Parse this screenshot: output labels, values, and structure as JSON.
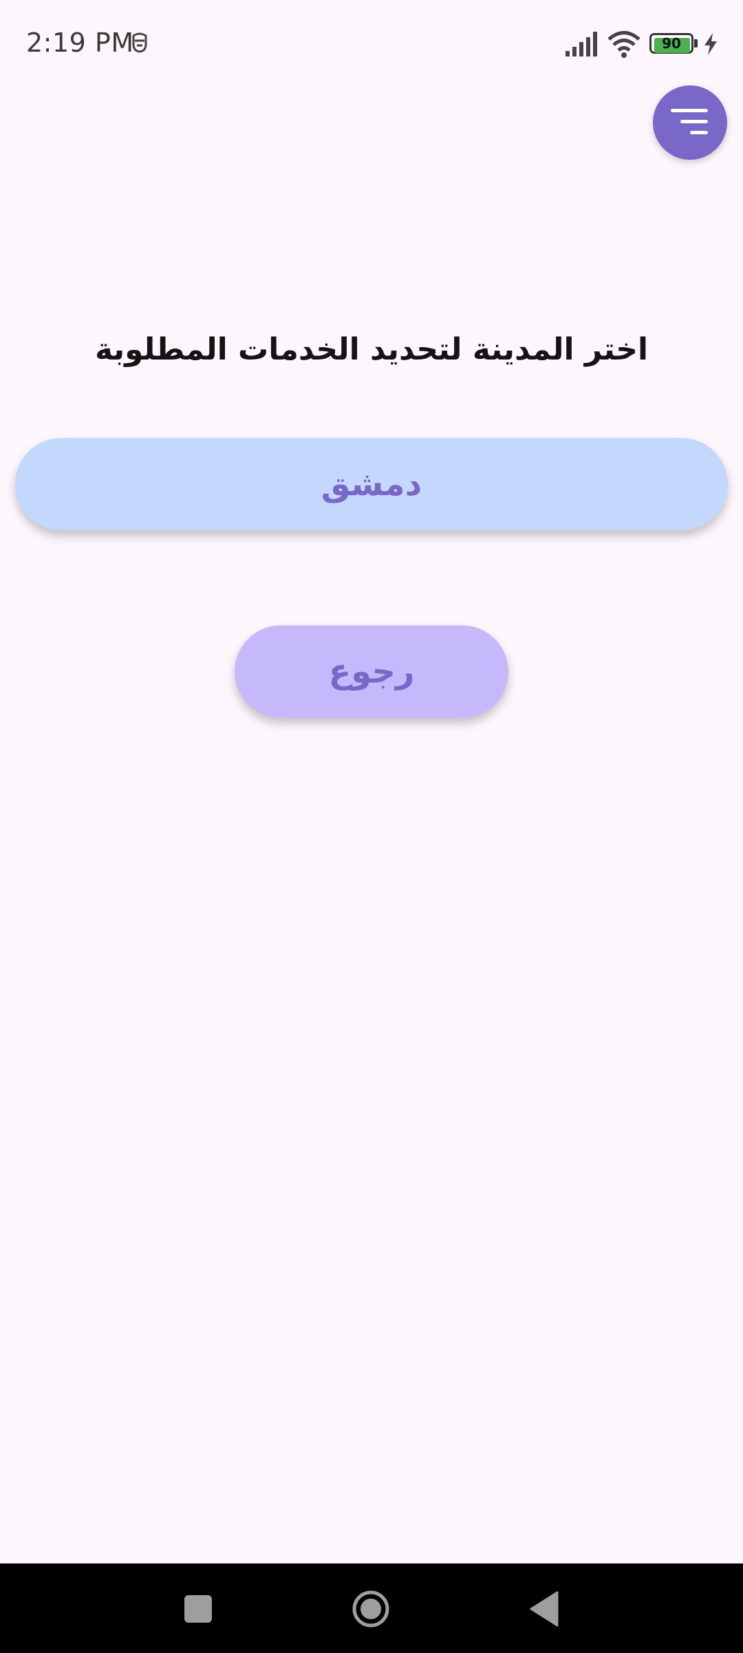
{
  "status_bar": {
    "time": "2:19 PM",
    "battery_level": "90",
    "icons": [
      "notification-icon",
      "signal-icon",
      "wifi-icon",
      "battery-icon",
      "charging-icon"
    ]
  },
  "header": {
    "menu_icon": "menu-filter-icon"
  },
  "main": {
    "title": "اختر المدينة لتحديد الخدمات المطلوبة",
    "city_button_label": "دمشق",
    "back_button_label": "رجوع"
  },
  "nav_bar": {
    "icons": [
      "recents-icon",
      "home-icon",
      "back-icon"
    ]
  },
  "colors": {
    "background": "#fdf6fc",
    "accent": "#7a68c8",
    "city_button_bg": "#c4d7fd",
    "back_button_bg": "#c5b9fc",
    "battery_fill": "#4caf50"
  }
}
